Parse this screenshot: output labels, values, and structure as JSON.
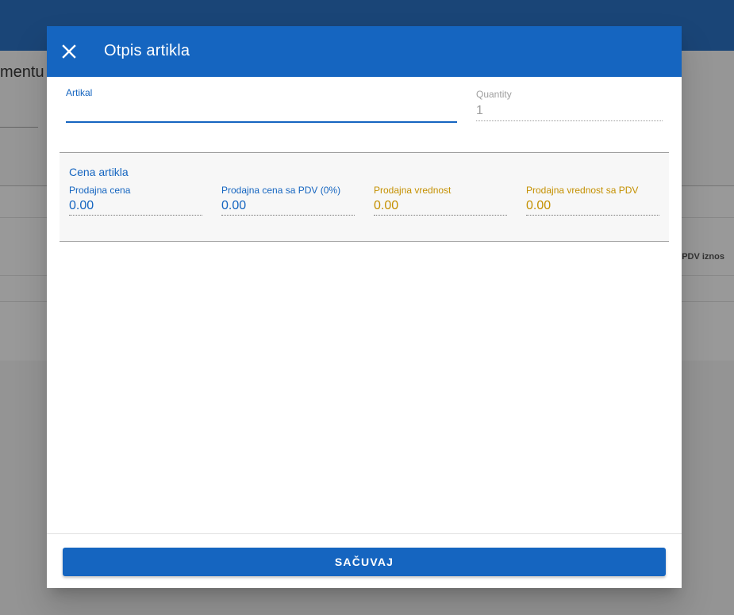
{
  "background": {
    "heading_fragment": "mentu",
    "column_header": "PDV iznos"
  },
  "dialog": {
    "title": "Otpis artikla",
    "close_icon": "close-icon",
    "artikal": {
      "label": "Artikal",
      "value": ""
    },
    "quantity": {
      "label": "Quantity",
      "value": "1"
    },
    "section": {
      "title": "Cena artikla",
      "fields": [
        {
          "label": "Prodajna cena",
          "value": "0.00"
        },
        {
          "label": "Prodajna cena sa PDV (0%)",
          "value": "0.00"
        },
        {
          "label": "Prodajna vrednost",
          "value": "0.00"
        },
        {
          "label": "Prodajna vrednost sa PDV",
          "value": "0.00"
        }
      ]
    },
    "save_label": "SAČUVAJ"
  },
  "colors": {
    "primary": "#1565c0",
    "accent_gold": "#c49000",
    "muted": "#9e9e9e"
  }
}
